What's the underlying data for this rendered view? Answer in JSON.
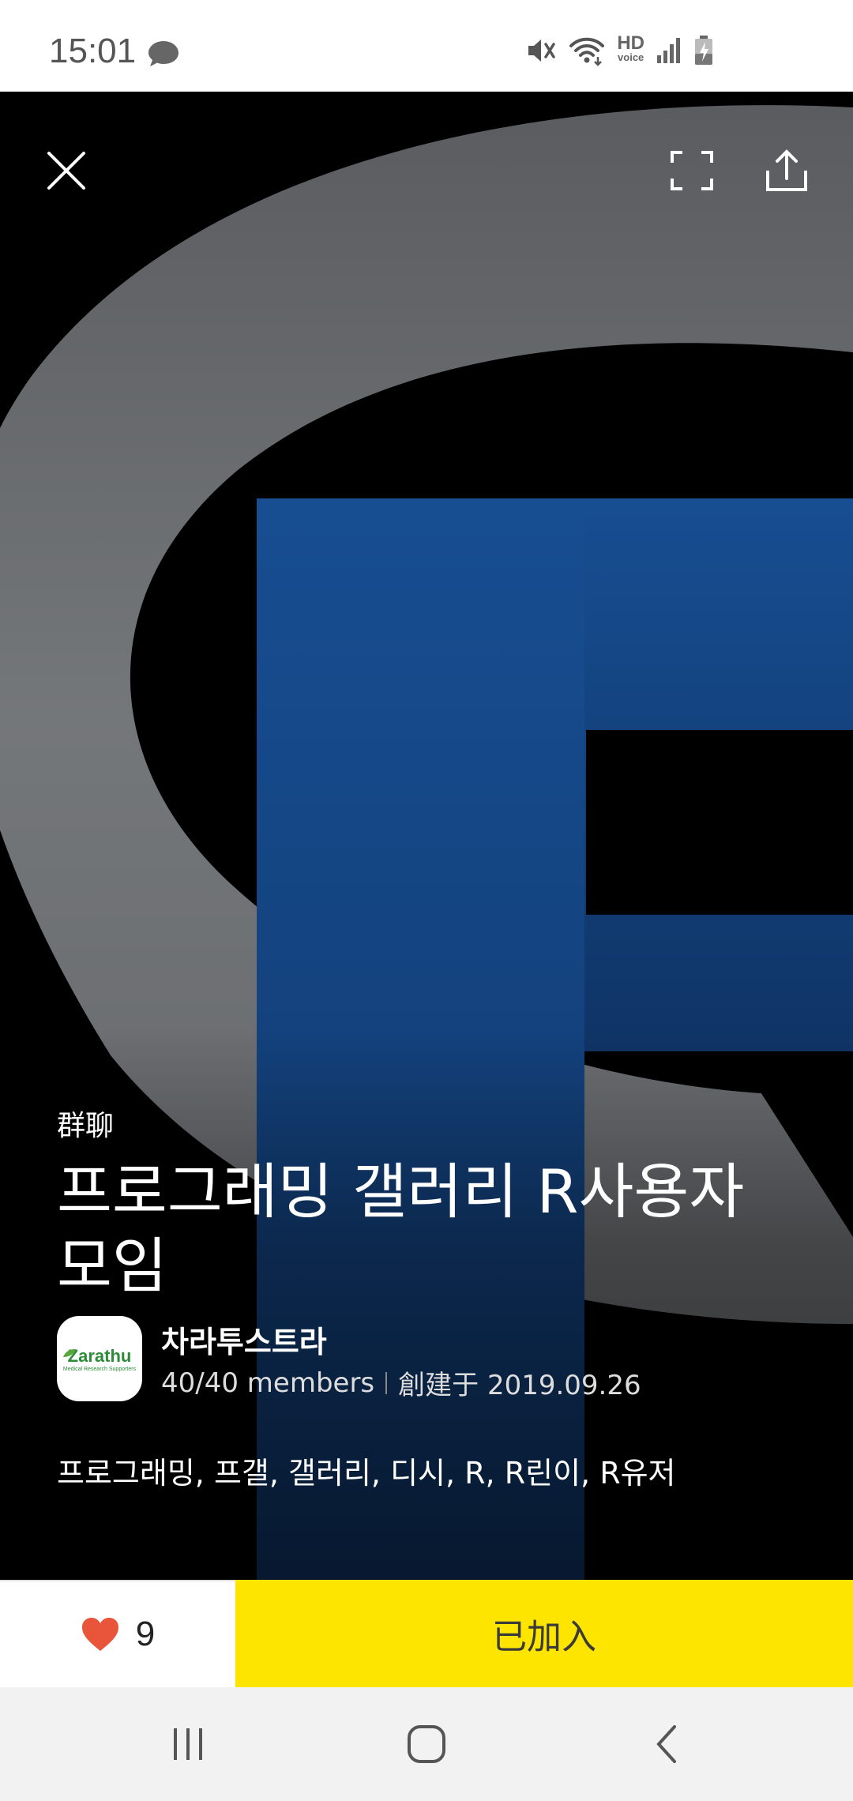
{
  "status_bar": {
    "time": "15:01",
    "icons": [
      "chat-bubble-icon",
      "mute-icon",
      "wifi-icon",
      "hd-voice-icon",
      "signal-icon",
      "battery-charging-icon"
    ],
    "hd_label": "HD",
    "voice_label": "voice"
  },
  "header": {
    "close_icon": "close-icon",
    "fullscreen_icon": "expand-icon",
    "share_icon": "share-icon"
  },
  "room": {
    "type": "群聊",
    "title": "프로그래밍 갤러리 R사용자 모임",
    "owner": {
      "name": "차라투스트라",
      "avatar_text": "Zarathu",
      "avatar_subtext": "Medical Research Supporters"
    },
    "members": "40/40 members",
    "created": "創建于 2019.09.26",
    "tags": "프로그래밍, 프갤, 갤러리, 디시, R, R린이, R유저"
  },
  "actions": {
    "like_count": "9",
    "join_label": "已加入"
  },
  "colors": {
    "join_button": "#fee500",
    "heart": "#e8553a",
    "r_blue": "#0f3466",
    "ring_gray": "#6e7073"
  }
}
